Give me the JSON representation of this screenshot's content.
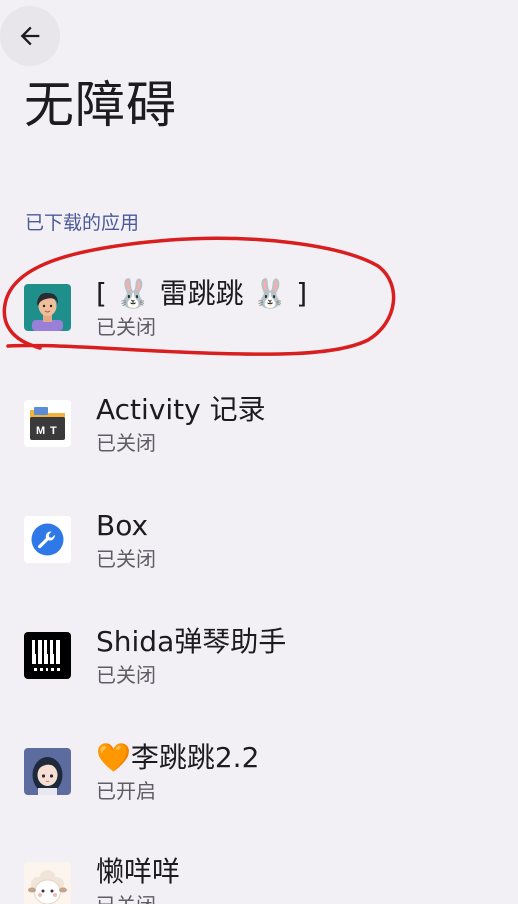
{
  "header": {
    "back_icon": "arrow-left-icon",
    "title": "无障碍"
  },
  "section": {
    "label": "已下载的应用"
  },
  "apps": [
    {
      "name": "[ 🐰 雷跳跳 🐰 ]",
      "status": "已关闭",
      "icon": "avatar-man-icon"
    },
    {
      "name": "Activity 记录",
      "status": "已关闭",
      "icon": "mt-folder-icon"
    },
    {
      "name": "Box",
      "status": "已关闭",
      "icon": "wrench-icon"
    },
    {
      "name": "Shida弹琴助手",
      "status": "已关闭",
      "icon": "shida-piano-icon"
    },
    {
      "name": "🧡李跳跳2.2",
      "status": "已开启",
      "icon": "girl-avatar-icon"
    },
    {
      "name": "懒咩咩",
      "status": "已关闭",
      "icon": "sheep-icon"
    }
  ],
  "colors": {
    "background": "#f3f0f5",
    "section_header": "#4a5a9a",
    "annotation_circle": "#d81e1e"
  }
}
